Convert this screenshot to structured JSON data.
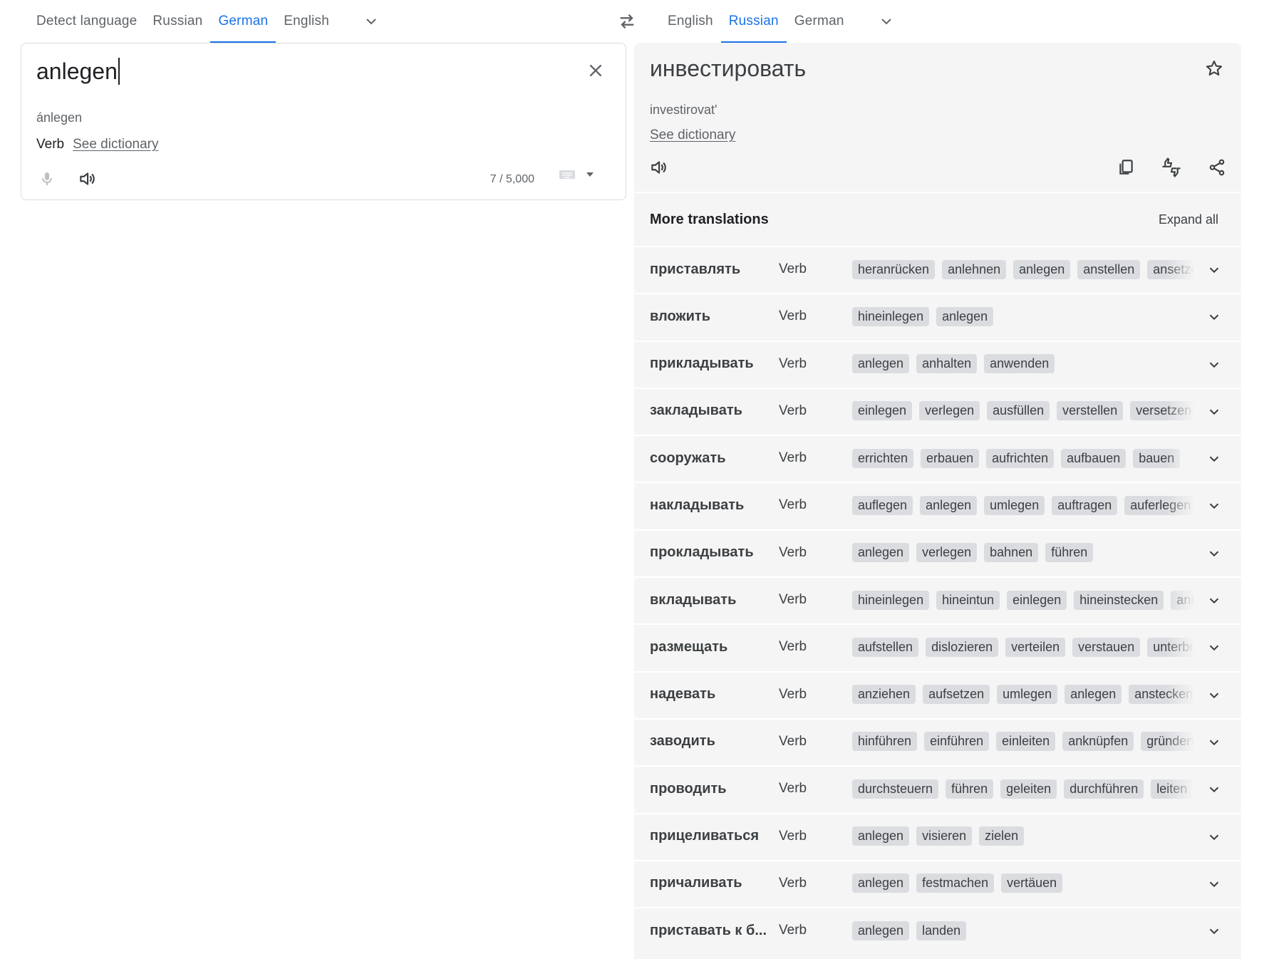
{
  "source_langs": {
    "tabs": [
      "Detect language",
      "Russian",
      "German",
      "English"
    ],
    "active_index": 2
  },
  "target_langs": {
    "tabs": [
      "English",
      "Russian",
      "German"
    ],
    "active_index": 1
  },
  "source": {
    "text": "anlegen",
    "transliteration": "ánlegen",
    "part_of_speech": "Verb",
    "see_dictionary": "See dictionary",
    "char_count": "7 / 5,000"
  },
  "target": {
    "text": "инвестировать",
    "transliteration": "investirovat'",
    "see_dictionary": "See dictionary"
  },
  "more_translations": {
    "title": "More translations",
    "expand_all": "Expand all",
    "rows": [
      {
        "word": "приставлять",
        "pos": "Verb",
        "chips": [
          "heranrücken",
          "anlehnen",
          "anlegen",
          "anstellen",
          "ansetzen"
        ]
      },
      {
        "word": "вложить",
        "pos": "Verb",
        "chips": [
          "hineinlegen",
          "anlegen"
        ]
      },
      {
        "word": "прикладывать",
        "pos": "Verb",
        "chips": [
          "anlegen",
          "anhalten",
          "anwenden"
        ]
      },
      {
        "word": "закладывать",
        "pos": "Verb",
        "chips": [
          "einlegen",
          "verlegen",
          "ausfüllen",
          "verstellen",
          "versetzen"
        ]
      },
      {
        "word": "сооружать",
        "pos": "Verb",
        "chips": [
          "errichten",
          "erbauen",
          "aufrichten",
          "aufbauen",
          "bauen"
        ]
      },
      {
        "word": "накладывать",
        "pos": "Verb",
        "chips": [
          "auflegen",
          "anlegen",
          "umlegen",
          "auftragen",
          "auferlegen"
        ]
      },
      {
        "word": "прокладывать",
        "pos": "Verb",
        "chips": [
          "anlegen",
          "verlegen",
          "bahnen",
          "führen"
        ]
      },
      {
        "word": "вкладывать",
        "pos": "Verb",
        "chips": [
          "hineinlegen",
          "hineintun",
          "einlegen",
          "hineinstecken",
          "anlegen"
        ]
      },
      {
        "word": "размещать",
        "pos": "Verb",
        "chips": [
          "aufstellen",
          "dislozieren",
          "verteilen",
          "verstauen",
          "unterbringen"
        ]
      },
      {
        "word": "надевать",
        "pos": "Verb",
        "chips": [
          "anziehen",
          "aufsetzen",
          "umlegen",
          "anlegen",
          "anstecken"
        ]
      },
      {
        "word": "заводить",
        "pos": "Verb",
        "chips": [
          "hinführen",
          "einführen",
          "einleiten",
          "anknüpfen",
          "gründen"
        ]
      },
      {
        "word": "проводить",
        "pos": "Verb",
        "chips": [
          "durchsteuern",
          "führen",
          "geleiten",
          "durchführen",
          "leiten"
        ]
      },
      {
        "word": "прицеливаться",
        "pos": "Verb",
        "chips": [
          "anlegen",
          "visieren",
          "zielen"
        ]
      },
      {
        "word": "причаливать",
        "pos": "Verb",
        "chips": [
          "anlegen",
          "festmachen",
          "vertäuen"
        ]
      },
      {
        "word": "приставать к б...",
        "pos": "Verb",
        "chips": [
          "anlegen",
          "landen"
        ]
      }
    ]
  },
  "colors": {
    "accent": "#1a73e8",
    "panel": "#f5f5f5",
    "chip": "#dadce0",
    "muted": "#5f6368"
  }
}
